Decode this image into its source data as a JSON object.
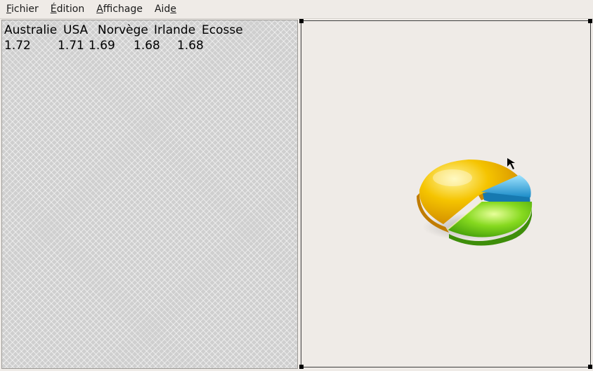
{
  "menu": {
    "items": [
      {
        "pre": "",
        "mnemonic": "F",
        "post": "ichier"
      },
      {
        "pre": "",
        "mnemonic": "É",
        "post": "dition"
      },
      {
        "pre": "",
        "mnemonic": "A",
        "post": "ffichage"
      },
      {
        "pre": "Aid",
        "mnemonic": "e",
        "post": ""
      }
    ]
  },
  "table": {
    "headers": [
      "Australie",
      "USA",
      "Norvège",
      "Irlande",
      "Ecosse"
    ],
    "values": [
      "1.72",
      "1.71",
      "1.69",
      "1.68",
      "1.68"
    ]
  },
  "chart": {
    "icon": "pie-chart-icon",
    "colors": {
      "yellow": "#f5c400",
      "green": "#7fd321",
      "blue": "#29a8e0"
    }
  }
}
